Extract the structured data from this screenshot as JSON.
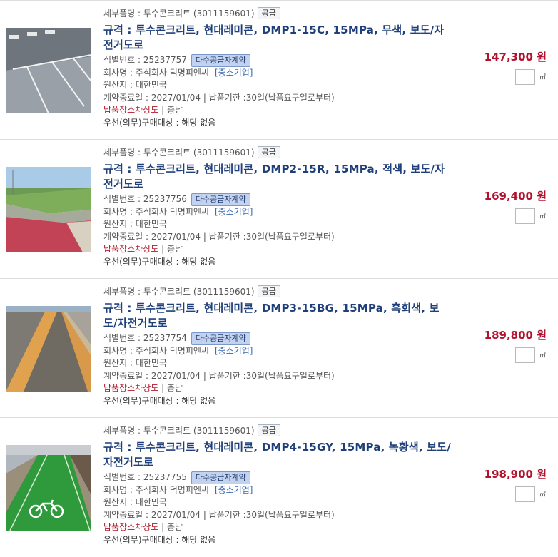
{
  "items": [
    {
      "category_label": "세부품명 : 투수콘크리트 (3011159601)",
      "supply_badge": "공급",
      "title_prefix": "규격 :",
      "title": "투수콘크리트, 현대레미콘, DMP1-15C, 15MPa, 무색, 보도/자전거도로",
      "id_label": "식별번호 : 25237757",
      "contract_badge": "다수공급자계약",
      "company_label": "회사명 : 주식회사 덕명피엔씨",
      "company_type": "[중소기업]",
      "origin_label": "원산지 : 대한민국",
      "contract_info": "계약종료일 : 2027/01/04 | 납품기한 :30일(납품요구일로부터)",
      "delivery_label": "납품장소차상도",
      "delivery_region": "| 충남",
      "priority": "우선(의무)구매대상 : 해당 없음",
      "price": "147,300 원",
      "unit": "㎥",
      "image": "parking-lot-pavement"
    },
    {
      "category_label": "세부품명 : 투수콘크리트 (3011159601)",
      "supply_badge": "공급",
      "title_prefix": "규격 :",
      "title": "투수콘크리트, 현대레미콘, DMP2-15R, 15MPa, 적색, 보도/자전거도로",
      "id_label": "식별번호 : 25237756",
      "contract_badge": "다수공급자계약",
      "company_label": "회사명 : 주식회사 덕명피엔씨",
      "company_type": "[중소기업]",
      "origin_label": "원산지 : 대한민국",
      "contract_info": "계약종료일 : 2027/01/04 | 납품기한 :30일(납품요구일로부터)",
      "delivery_label": "납품장소차상도",
      "delivery_region": "| 충남",
      "priority": "우선(의무)구매대상 : 해당 없음",
      "price": "169,400 원",
      "unit": "㎥",
      "image": "red-pavement"
    },
    {
      "category_label": "세부품명 : 투수콘크리트 (3011159601)",
      "supply_badge": "공급",
      "title_prefix": "규격 :",
      "title": "투수콘크리트, 현대레미콘, DMP3-15BG, 15MPa, 흑회색, 보도/자전거도로",
      "id_label": "식별번호 : 25237754",
      "contract_badge": "다수공급자계약",
      "company_label": "회사명 : 주식회사 덕명피엔씨",
      "company_type": "[중소기업]",
      "origin_label": "원산지 : 대한민국",
      "contract_info": "계약종료일 : 2027/01/04 | 납품기한 :30일(납품요구일로부터)",
      "delivery_label": "납품장소차상도",
      "delivery_region": "| 충남",
      "priority": "우선(의무)구매대상 : 해당 없음",
      "price": "189,800 원",
      "unit": "㎥",
      "image": "gray-path"
    },
    {
      "category_label": "세부품명 : 투수콘크리트 (3011159601)",
      "supply_badge": "공급",
      "title_prefix": "규격 :",
      "title": "투수콘크리트, 현대레미콘, DMP4-15GY, 15MPa, 녹황색, 보도/자전거도로",
      "id_label": "식별번호 : 25237755",
      "contract_badge": "다수공급자계약",
      "company_label": "회사명 : 주식회사 덕명피엔씨",
      "company_type": "[중소기업]",
      "origin_label": "원산지 : 대한민국",
      "contract_info": "계약종료일 : 2027/01/04 | 납품기한 :30일(납품요구일로부터)",
      "delivery_label": "납품장소차상도",
      "delivery_region": "| 충남",
      "priority": "우선(의무)구매대상 : 해당 없음",
      "price": "198,900 원",
      "unit": "㎥",
      "image": "green-bike-lane"
    }
  ]
}
